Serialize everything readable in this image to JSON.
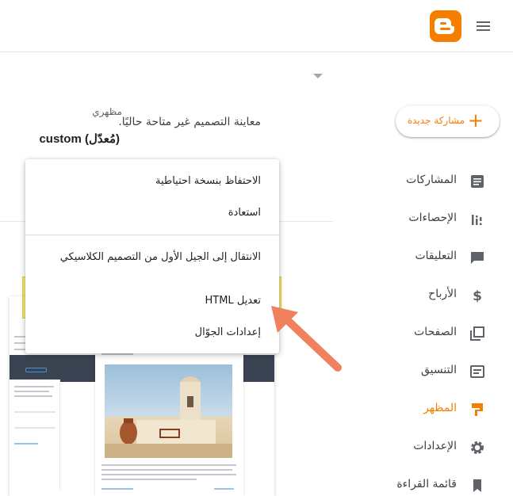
{
  "header": {
    "logo_icon": "blogger-logo-icon",
    "menu_icon": "hamburger-menu-icon"
  },
  "theme": {
    "label": "مظهري",
    "preview_note": "معاينة التصميم غير متاحة حاليًا.",
    "name": "custom (مُعدّل)"
  },
  "sidebar": {
    "new_post": "مشاركة جديدة",
    "items": [
      {
        "label": "المشاركات",
        "icon": "posts-icon"
      },
      {
        "label": "الإحصاءات",
        "icon": "stats-icon"
      },
      {
        "label": "التعليقات",
        "icon": "comments-icon"
      },
      {
        "label": "الأرباح",
        "icon": "dollar-icon"
      },
      {
        "label": "الصفحات",
        "icon": "pages-icon"
      },
      {
        "label": "التنسيق",
        "icon": "layout-icon"
      },
      {
        "label": "المظهر",
        "icon": "theme-brush-icon",
        "active": true
      },
      {
        "label": "الإعدادات",
        "icon": "gear-icon"
      },
      {
        "label": "قائمة القراءة",
        "icon": "bookmark-icon"
      }
    ]
  },
  "menu": {
    "items": [
      "الاحتفاظ بنسخة احتياطية",
      "استعادة",
      "الانتقال إلى الجيل الأول من التصميم الكلاسيكي",
      "تعديل HTML",
      "إعدادات الجوّال"
    ]
  },
  "colors": {
    "accent": "#f57d00",
    "highlight": "#f0de3c",
    "arrow": "#f0805e"
  }
}
